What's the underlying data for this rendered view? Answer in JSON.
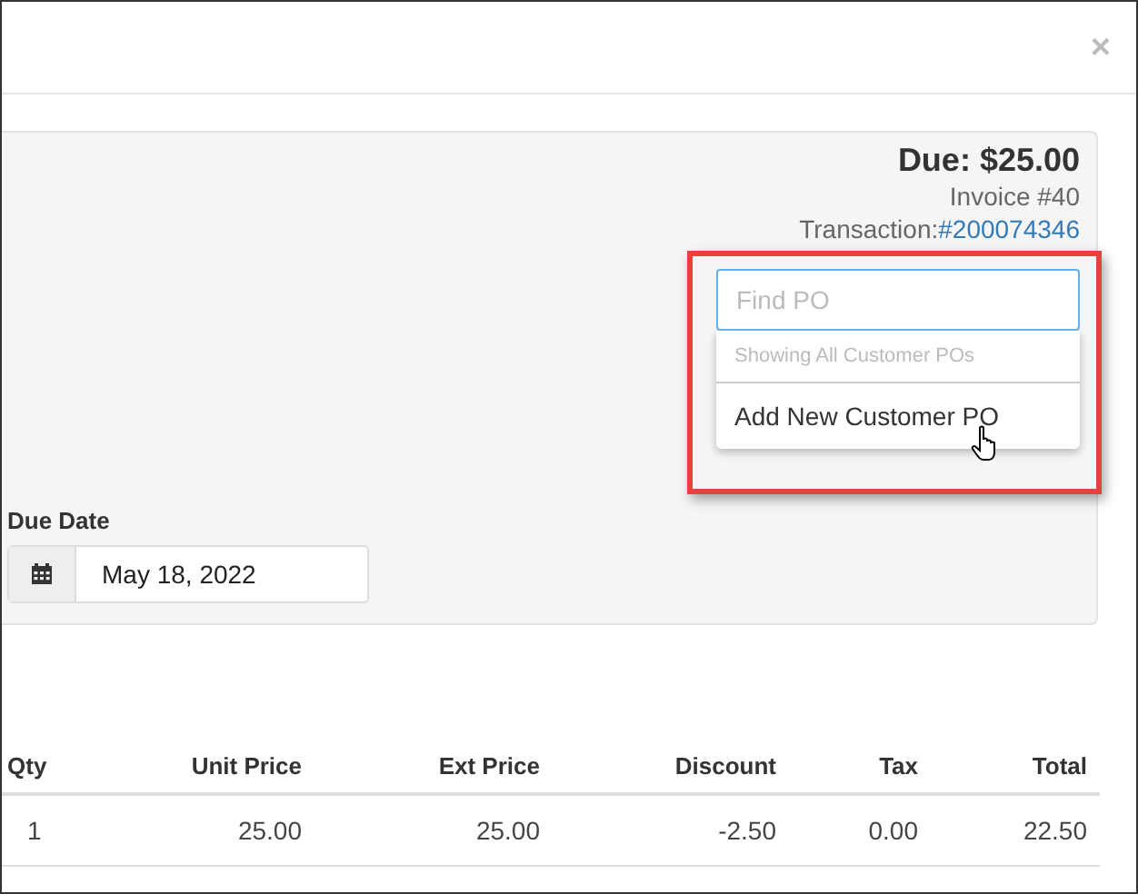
{
  "modal": {
    "close": "×"
  },
  "summary": {
    "due": "Due: $25.00",
    "invoice": "Invoice #40",
    "transaction_label": "Transaction:",
    "transaction_number": "#200074346"
  },
  "due_date": {
    "label": "Due Date",
    "value": "May 18, 2022"
  },
  "po_search": {
    "placeholder": "Find PO",
    "header": "Showing All Customer POs",
    "items": [
      "Add New Customer PO"
    ]
  },
  "table": {
    "columns": [
      "Qty",
      "Unit Price",
      "Ext Price",
      "Discount",
      "Tax",
      "Total"
    ],
    "rows": [
      [
        "1",
        "25.00",
        "25.00",
        "-2.50",
        "0.00",
        "22.50"
      ]
    ]
  }
}
